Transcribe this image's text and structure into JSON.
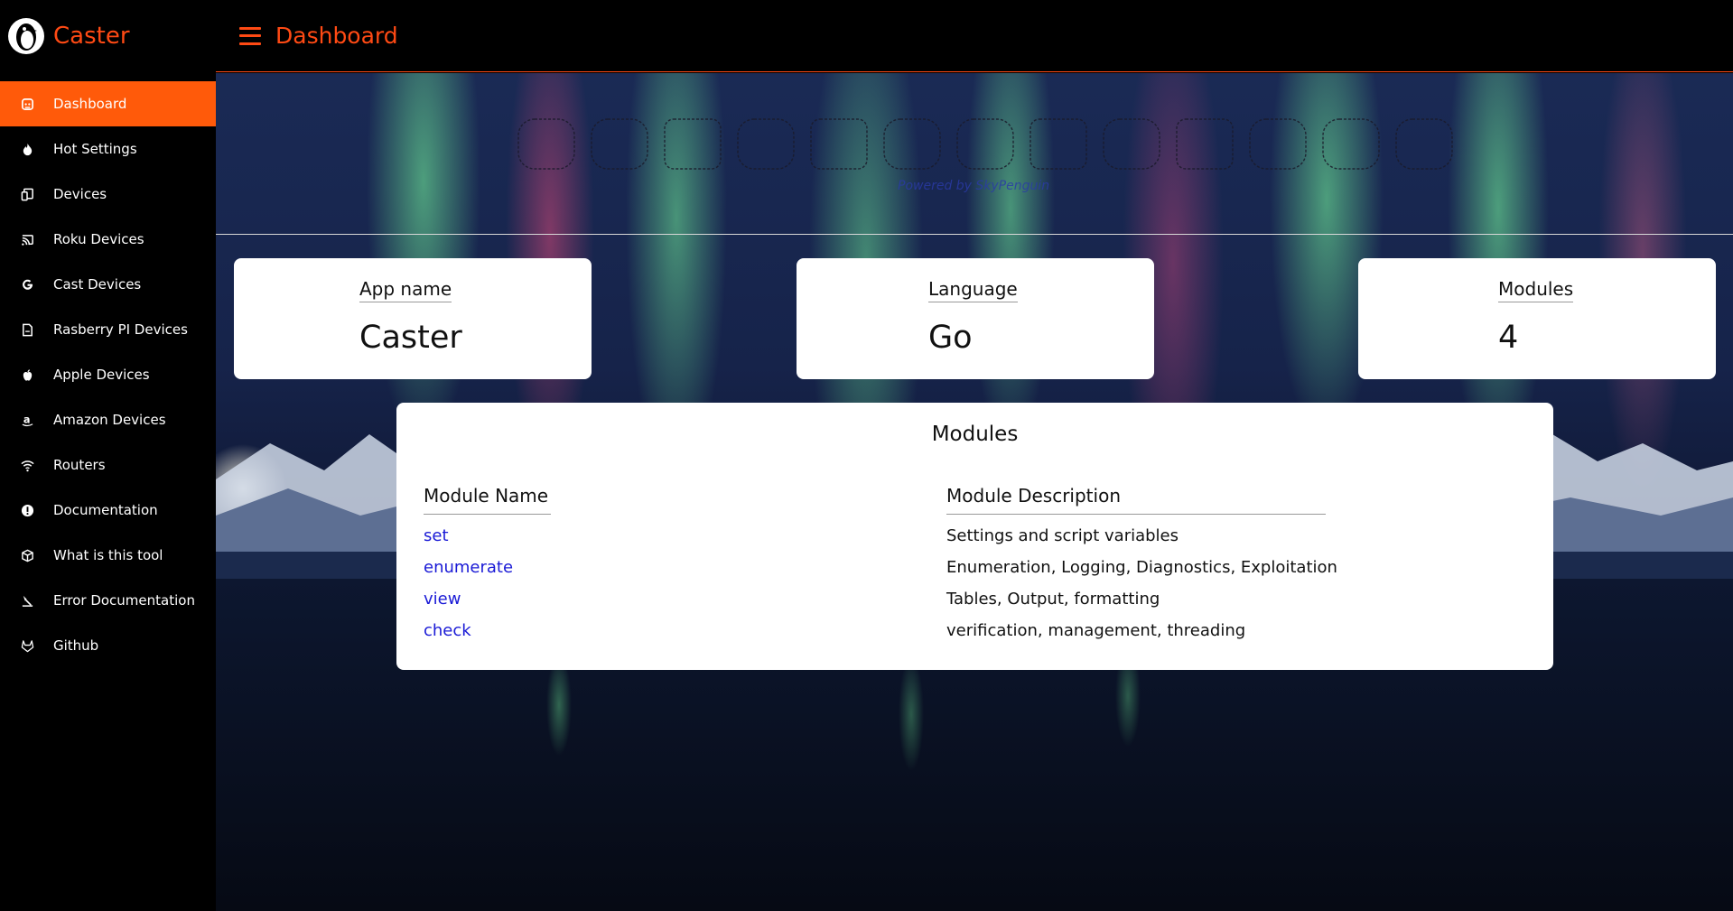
{
  "brand": {
    "name": "Caster"
  },
  "sidebar": {
    "items": [
      {
        "label": "Dashboard",
        "icon": "dashboard-icon",
        "active": true
      },
      {
        "label": "Hot Settings",
        "icon": "flame-icon"
      },
      {
        "label": "Devices",
        "icon": "devices-icon"
      },
      {
        "label": "Roku Devices",
        "icon": "cast-icon"
      },
      {
        "label": "Cast Devices",
        "icon": "google-icon"
      },
      {
        "label": "Rasberry PI Devices",
        "icon": "document-icon"
      },
      {
        "label": "Apple Devices",
        "icon": "apple-icon"
      },
      {
        "label": "Amazon Devices",
        "icon": "amazon-icon"
      },
      {
        "label": "Routers",
        "icon": "wifi-icon"
      },
      {
        "label": "Documentation",
        "icon": "info-icon"
      },
      {
        "label": "What is this tool",
        "icon": "cube-icon"
      },
      {
        "label": "Error Documentation",
        "icon": "error-doc-icon"
      },
      {
        "label": "Github",
        "icon": "gitlab-icon"
      }
    ]
  },
  "topbar": {
    "title": "Dashboard"
  },
  "banner": {
    "subtitle": "Powered by SkyPenguin"
  },
  "stats": [
    {
      "label": "App name",
      "value": "Caster"
    },
    {
      "label": "Language",
      "value": "Go"
    },
    {
      "label": "Modules",
      "value": "4"
    }
  ],
  "modules": {
    "title": "Modules",
    "headers": [
      "Module Name",
      "Module Description"
    ],
    "rows": [
      {
        "name": "set",
        "description": "Settings and script variables"
      },
      {
        "name": "enumerate",
        "description": "Enumeration, Logging, Diagnostics, Exploitation"
      },
      {
        "name": "view",
        "description": "Tables, Output, formatting"
      },
      {
        "name": "check",
        "description": "verification, management, threading"
      }
    ]
  },
  "colors": {
    "accent": "#ff4a14",
    "active_nav": "#ff5a0a",
    "link": "#1a1ad6"
  }
}
